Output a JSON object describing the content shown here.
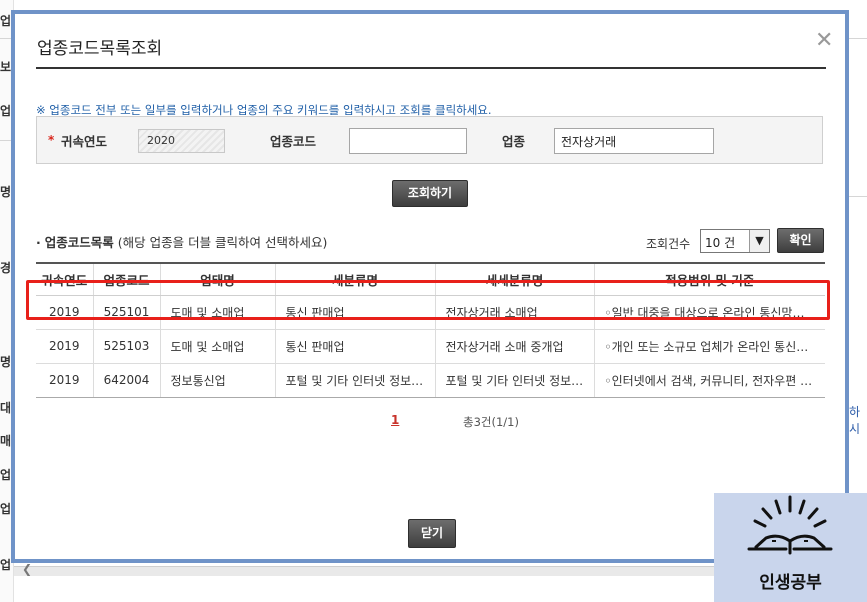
{
  "background": {
    "left_fragments": [
      "업",
      "보",
      "업",
      "명",
      "경",
      "명",
      "대역",
      "매출",
      "업",
      "업",
      "업"
    ],
    "right_fragment": "하시"
  },
  "dialog": {
    "title": "업종코드목록조회",
    "notice": "※ 업종코드 전부 또는 일부를 입력하거나 업종의 주요 키워드를 입력하시고 조회를 클릭하세요.",
    "search": {
      "required_mark": "*",
      "year_label": "귀속연도",
      "year_value": "2020",
      "code_label": "업종코드",
      "code_value": "",
      "industry_label": "업종",
      "industry_value": "전자상거래"
    },
    "search_button": "조회하기",
    "list": {
      "title": "업종코드목록",
      "hint": "(해당 업종을 더블 클릭하여 선택하세요)",
      "count_label": "조회건수",
      "count_value": "10 건",
      "confirm_button": "확인"
    },
    "table": {
      "headers": [
        "귀속연도",
        "업종코드",
        "업태명",
        "세분류명",
        "세세분류명",
        "적용범위 및 기준"
      ],
      "rows": [
        [
          "2019",
          "525101",
          "도매 및 소매업",
          "통신 판매업",
          "전자상거래 소매업",
          "◦일반 대중을 대상으로 온라인 통신망을 통하여 각종 상품을 소매하는 산업활동"
        ],
        [
          "2019",
          "525103",
          "도매 및 소매업",
          "통신 판매업",
          "전자상거래 소매 중개업",
          "◦개인 또는 소규모 업체가 온라인 통신망을 통하여 상품을 거래할 수 있도록"
        ],
        [
          "2019",
          "642004",
          "정보통신업",
          "포털 및 기타 인터넷 정보매개 서비스업",
          "포털 및 기타 인터넷 정보매개 서비스업",
          "◦인터넷에서 검색, 커뮤니티, 전자우편 등 서비스를"
        ]
      ]
    },
    "pagination": {
      "current_page": "1",
      "total": "총3건(1/1)"
    },
    "close_button": "닫기"
  },
  "watermark": {
    "text": "인생공부"
  },
  "colors": {
    "modal_border": "#6f93c8",
    "notice_text": "#2160a8",
    "highlight": "#e8201a",
    "required": "#d9261c",
    "watermark_bg": "#c9d5ec"
  }
}
